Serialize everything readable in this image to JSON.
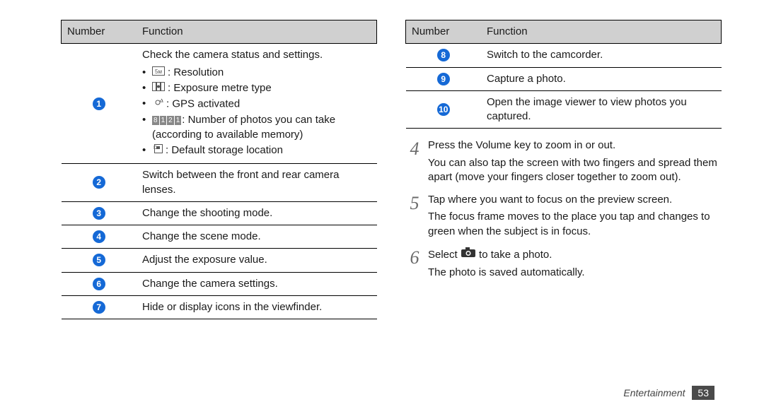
{
  "left_table": {
    "headers": [
      "Number",
      "Function"
    ],
    "rows": [
      {
        "num": "1",
        "intro": "Check the camera status and settings.",
        "items": [
          {
            "icon": "resolution-icon",
            "label": "Resolution"
          },
          {
            "icon": "exposure-metre-icon",
            "label": "Exposure metre type"
          },
          {
            "icon": "gps-icon",
            "label": "GPS activated"
          },
          {
            "icon": "counter-icon",
            "label": "Number of photos you can take (according to available memory)"
          },
          {
            "icon": "storage-icon",
            "label": "Default storage location"
          }
        ]
      },
      {
        "num": "2",
        "text": "Switch between the front and rear camera lenses."
      },
      {
        "num": "3",
        "text": "Change the shooting mode."
      },
      {
        "num": "4",
        "text": "Change the scene mode."
      },
      {
        "num": "5",
        "text": "Adjust the exposure value."
      },
      {
        "num": "6",
        "text": "Change the camera settings."
      },
      {
        "num": "7",
        "text": "Hide or display icons in the viewfinder."
      }
    ]
  },
  "right_table": {
    "headers": [
      "Number",
      "Function"
    ],
    "rows": [
      {
        "num": "8",
        "text": "Switch to the camcorder."
      },
      {
        "num": "9",
        "text": "Capture a photo."
      },
      {
        "num": "10",
        "text": "Open the image viewer to view photos you captured."
      }
    ]
  },
  "steps": [
    {
      "n": "4",
      "paras": [
        "Press the Volume key to zoom in or out.",
        "You can also tap the screen with two fingers and spread them apart (move your fingers closer together to zoom out)."
      ]
    },
    {
      "n": "5",
      "paras": [
        "Tap where you want to focus on the preview screen.",
        "The focus frame moves to the place you tap and changes to green when the subject is in focus."
      ]
    },
    {
      "n": "6",
      "select_prefix": "Select ",
      "select_suffix": " to take a photo.",
      "paras_after": [
        "The photo is saved automatically."
      ]
    }
  ],
  "footer": {
    "section": "Entertainment",
    "page": "53"
  }
}
